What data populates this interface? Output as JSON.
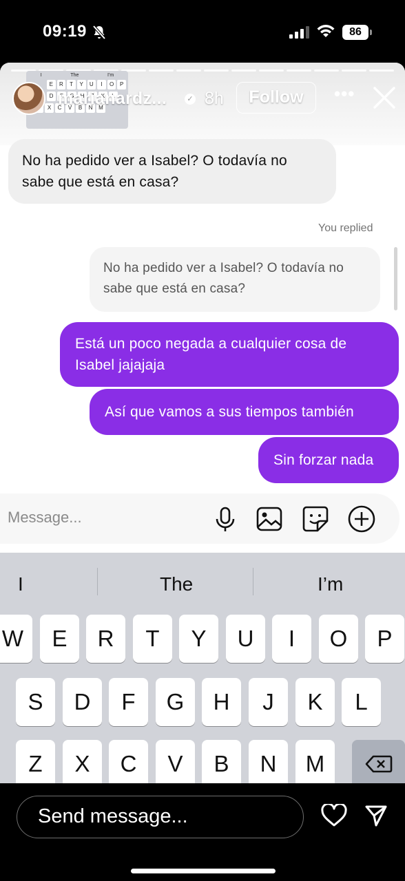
{
  "status_bar": {
    "time": "09:19",
    "battery": "86"
  },
  "story": {
    "username": "marianardz...",
    "time_ago": "8h",
    "follow_label": "Follow",
    "more_label": "•••",
    "mini_keyboard": {
      "suggestions": [
        "I",
        "The",
        "I'm"
      ],
      "row1": [
        "E",
        "R",
        "T",
        "Y",
        "U",
        "I",
        "O",
        "P"
      ],
      "row2": [
        "D",
        "F",
        "G",
        "H",
        "J",
        "K",
        "L"
      ],
      "row3": [
        "Z",
        "X",
        "C",
        "V",
        "B",
        "N",
        "M"
      ]
    }
  },
  "chat": {
    "incoming": "No ha pedido ver a Isabel? O todavía no sabe que está en casa?",
    "replied_label": "You replied",
    "quoted": "No ha pedido ver a Isabel? O todavía no sabe que está en casa?",
    "outgoing": [
      "Está un poco negada a cualquier cosa de Isabel jajajaja",
      "Así que vamos a sus tiempos también",
      "Sin forzar nada"
    ]
  },
  "composer": {
    "placeholder": "Message..."
  },
  "keyboard": {
    "suggestions": [
      "I",
      "The",
      "I’m"
    ],
    "row1": [
      "W",
      "E",
      "R",
      "T",
      "Y",
      "U",
      "I",
      "O",
      "P"
    ],
    "row2": [
      "S",
      "D",
      "F",
      "G",
      "H",
      "J",
      "K",
      "L"
    ],
    "row3": [
      "Z",
      "X",
      "C",
      "V",
      "B",
      "N",
      "M"
    ]
  },
  "bottom_bar": {
    "send_placeholder": "Send message..."
  }
}
